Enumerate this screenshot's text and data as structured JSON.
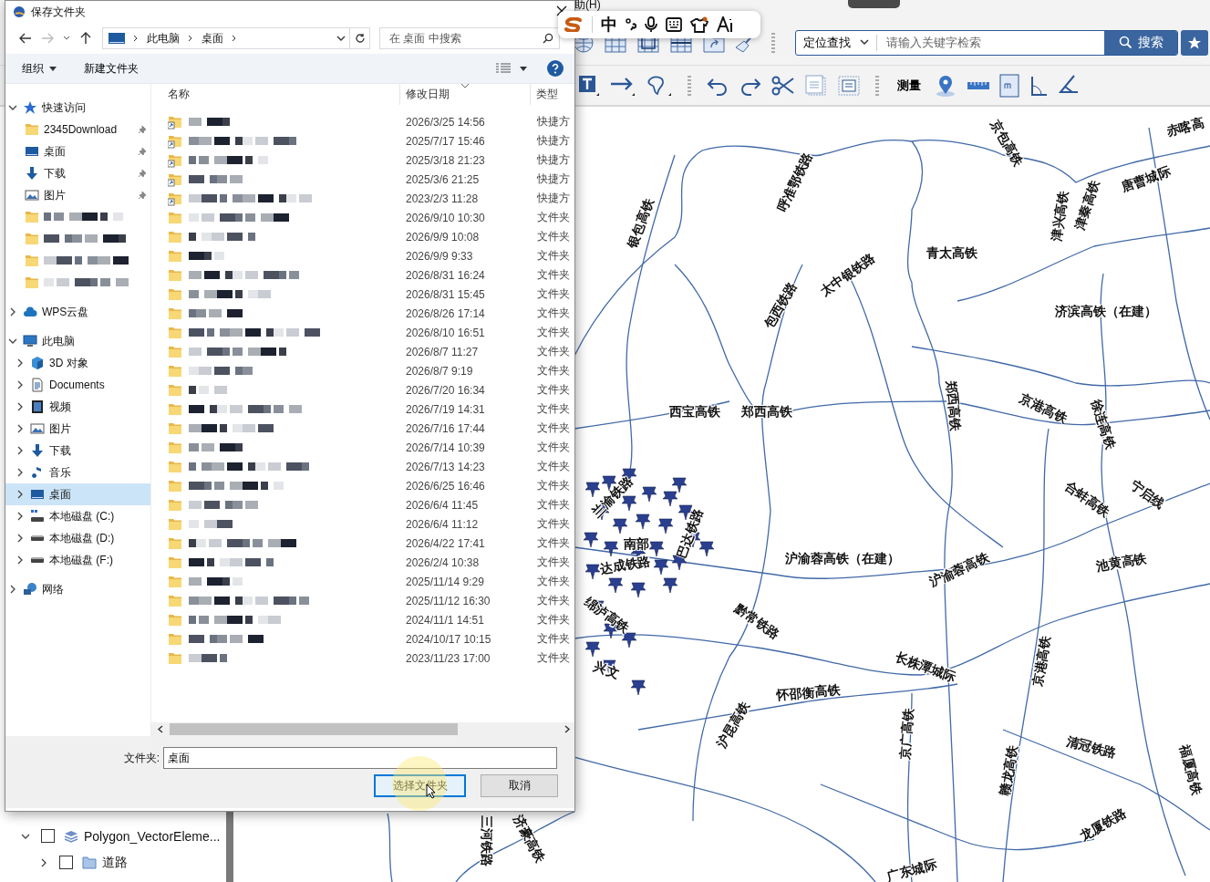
{
  "app": {
    "menu_fragment": "助(H)",
    "ime_bar": {
      "mode": "中"
    },
    "toolbar": {
      "search_scope": "定位查找",
      "search_placeholder": "请输入关键字检索",
      "search_button": "搜索",
      "measure_label": "测量"
    },
    "layer_tree": [
      {
        "label": "Polygon_VectorEleme...",
        "checked": false,
        "expanded": true,
        "children": [
          {
            "label": "道路",
            "checked": false,
            "expanded": false
          }
        ]
      }
    ],
    "map": {
      "labels": [
        {
          "text": "赤喀高"
        },
        {
          "text": "京包高铁"
        },
        {
          "text": "呼准鄂铁路"
        },
        {
          "text": "银包高铁"
        },
        {
          "text": "唐曹城际"
        },
        {
          "text": "津兴高铁"
        },
        {
          "text": "津秦高铁"
        },
        {
          "text": "青太高铁"
        },
        {
          "text": "太中银铁路"
        },
        {
          "text": "包西铁路"
        },
        {
          "text": "济滨高铁（在建）"
        },
        {
          "text": "西宝高铁"
        },
        {
          "text": "郑西高铁"
        },
        {
          "text": "郑西高铁"
        },
        {
          "text": "京港高铁"
        },
        {
          "text": "徐连高铁"
        },
        {
          "text": "合蚌高铁"
        },
        {
          "text": "宁启线"
        },
        {
          "text": "池黄高铁"
        },
        {
          "text": "沪渝蓉高铁（在建）"
        },
        {
          "text": "沪渝蓉高铁"
        },
        {
          "text": "黔常铁路"
        },
        {
          "text": "长株潭城际"
        },
        {
          "text": "京港高铁"
        },
        {
          "text": "怀邵衡高铁"
        },
        {
          "text": "沪昆高铁"
        },
        {
          "text": "京广高铁"
        },
        {
          "text": "赣龙高铁"
        },
        {
          "text": "清冠铁路"
        },
        {
          "text": "福厦高铁"
        },
        {
          "text": "龙厦铁路"
        },
        {
          "text": "广东城际"
        },
        {
          "text": "兰渝铁路"
        },
        {
          "text": "南部"
        },
        {
          "text": "达成铁路"
        },
        {
          "text": "巴达铁路"
        },
        {
          "text": "绵泸高铁"
        },
        {
          "text": "兴文"
        },
        {
          "text": "三河铁路"
        },
        {
          "text": "济豪高铁"
        }
      ]
    }
  },
  "dialog": {
    "title": "保存文件夹",
    "nav": {
      "forward_disabled": true
    },
    "address": {
      "crumbs": [
        "此电脑",
        "桌面"
      ]
    },
    "search": {
      "placeholder": "在 桌面 中搜索"
    },
    "commands": {
      "organize": "组织",
      "new_folder": "新建文件夹"
    },
    "sidebar": [
      {
        "label": "快速访问",
        "kind": "quick-access",
        "expanded": true,
        "selected": false,
        "children": [
          {
            "label": "2345Download",
            "kind": "folder",
            "pinned": true,
            "selected": false
          },
          {
            "label": "桌面",
            "kind": "desktop",
            "pinned": true,
            "selected": false
          },
          {
            "label": "下载",
            "kind": "download",
            "pinned": true,
            "selected": false
          },
          {
            "label": "图片",
            "kind": "pictures",
            "pinned": true,
            "selected": false
          },
          {
            "kind": "blurred-folder",
            "pinned": false,
            "selected": false
          },
          {
            "kind": "blurred-folder",
            "pinned": false,
            "selected": false
          },
          {
            "kind": "blurred-folder",
            "pinned": false,
            "selected": false
          },
          {
            "kind": "blurred-folder",
            "pinned": false,
            "selected": false
          }
        ]
      },
      {
        "label": "WPS云盘",
        "kind": "cloud",
        "expanded": false,
        "selected": false
      },
      {
        "label": "此电脑",
        "kind": "pc",
        "expanded": true,
        "selected": false,
        "children": [
          {
            "label": "3D 对象",
            "kind": "cube",
            "expanded": false,
            "selected": false
          },
          {
            "label": "Documents",
            "kind": "document",
            "expanded": false,
            "selected": false
          },
          {
            "label": "视频",
            "kind": "video",
            "expanded": false,
            "selected": false
          },
          {
            "label": "图片",
            "kind": "pictures",
            "expanded": false,
            "selected": false
          },
          {
            "label": "下载",
            "kind": "download",
            "expanded": false,
            "selected": false
          },
          {
            "label": "音乐",
            "kind": "music",
            "expanded": false,
            "selected": false
          },
          {
            "label": "桌面",
            "kind": "desktop",
            "expanded": false,
            "selected": true
          },
          {
            "label": "本地磁盘 (C:)",
            "kind": "system-drive",
            "expanded": false,
            "selected": false
          },
          {
            "label": "本地磁盘 (D:)",
            "kind": "drive",
            "expanded": false,
            "selected": false
          },
          {
            "label": "本地磁盘 (F:)",
            "kind": "drive",
            "expanded": false,
            "selected": false
          }
        ]
      },
      {
        "label": "网络",
        "kind": "network",
        "expanded": false,
        "selected": false
      }
    ],
    "columns": [
      {
        "label": "名称",
        "sorted": false
      },
      {
        "label": "修改日期",
        "sorted": true
      },
      {
        "label": "类型",
        "sorted": false
      }
    ],
    "files": [
      {
        "kind": "shortcut",
        "modified": "2026/3/25 14:56",
        "type": "快捷方"
      },
      {
        "kind": "shortcut",
        "modified": "2025/7/17 15:46",
        "type": "快捷方"
      },
      {
        "kind": "shortcut",
        "modified": "2025/3/18 21:23",
        "type": "快捷方"
      },
      {
        "kind": "shortcut",
        "modified": "2025/3/6 21:25",
        "type": "快捷方"
      },
      {
        "kind": "shortcut",
        "modified": "2023/2/3 11:28",
        "type": "快捷方"
      },
      {
        "kind": "folder",
        "modified": "2026/9/10 10:30",
        "type": "文件夹"
      },
      {
        "kind": "folder",
        "modified": "2026/9/9 10:08",
        "type": "文件夹"
      },
      {
        "kind": "folder",
        "modified": "2026/9/9 9:33",
        "type": "文件夹"
      },
      {
        "kind": "folder",
        "modified": "2026/8/31 16:24",
        "type": "文件夹"
      },
      {
        "kind": "folder",
        "modified": "2026/8/31 15:45",
        "type": "文件夹"
      },
      {
        "kind": "folder",
        "modified": "2026/8/26 17:14",
        "type": "文件夹"
      },
      {
        "kind": "folder",
        "modified": "2026/8/10 16:51",
        "type": "文件夹"
      },
      {
        "kind": "folder",
        "modified": "2026/8/7 11:27",
        "type": "文件夹"
      },
      {
        "kind": "folder",
        "modified": "2026/8/7 9:19",
        "type": "文件夹"
      },
      {
        "kind": "folder",
        "modified": "2026/7/20 16:34",
        "type": "文件夹"
      },
      {
        "kind": "folder",
        "modified": "2026/7/19 14:31",
        "type": "文件夹"
      },
      {
        "kind": "folder",
        "modified": "2026/7/16 17:44",
        "type": "文件夹"
      },
      {
        "kind": "folder",
        "modified": "2026/7/14 10:39",
        "type": "文件夹"
      },
      {
        "kind": "folder",
        "modified": "2026/7/13 14:23",
        "type": "文件夹"
      },
      {
        "kind": "folder",
        "modified": "2026/6/25 16:46",
        "type": "文件夹"
      },
      {
        "kind": "folder",
        "modified": "2026/6/4 11:45",
        "type": "文件夹"
      },
      {
        "kind": "folder",
        "modified": "2026/6/4 11:12",
        "type": "文件夹"
      },
      {
        "kind": "folder",
        "modified": "2026/4/22 17:41",
        "type": "文件夹"
      },
      {
        "kind": "folder",
        "modified": "2026/2/4 10:38",
        "type": "文件夹"
      },
      {
        "kind": "folder",
        "modified": "2025/11/14 9:29",
        "type": "文件夹"
      },
      {
        "kind": "folder",
        "modified": "2025/11/12 16:30",
        "type": "文件夹"
      },
      {
        "kind": "folder",
        "modified": "2024/11/1 14:51",
        "type": "文件夹"
      },
      {
        "kind": "folder",
        "modified": "2024/10/17 10:15",
        "type": "文件夹"
      },
      {
        "kind": "folder",
        "modified": "2023/11/23 17:00",
        "type": "文件夹"
      }
    ],
    "folder_field": {
      "label": "文件夹:",
      "value": "桌面"
    },
    "buttons": [
      {
        "label": "选择文件夹",
        "default": true
      },
      {
        "label": "取消",
        "default": false
      }
    ]
  }
}
